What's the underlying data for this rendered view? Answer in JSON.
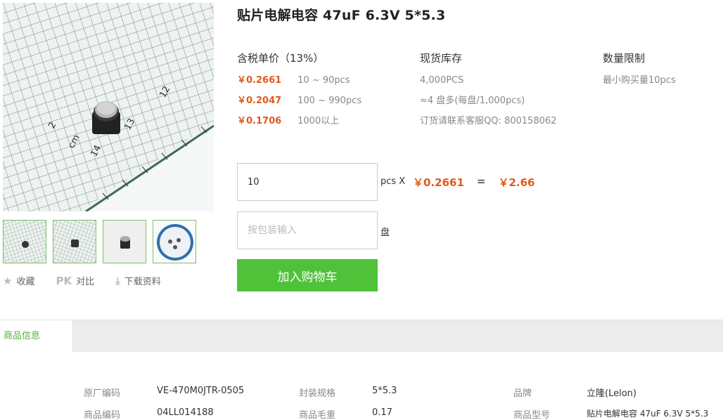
{
  "product": {
    "title": "贴片电解电容 47uF 6.3V 5*5.3"
  },
  "gallery": {
    "thumb_count": 4
  },
  "actions": [
    {
      "icon": "star-icon",
      "glyph": "★",
      "label": "收藏"
    },
    {
      "icon": "pk-icon",
      "glyph": "PK",
      "label": "对比"
    },
    {
      "icon": "download-icon",
      "glyph": "⤓",
      "label": "下载资料"
    }
  ],
  "pricing": {
    "header": "含税单价（13%）",
    "tiers": [
      {
        "price": "￥0.2661",
        "range": "10 ~ 90pcs"
      },
      {
        "price": "￥0.2047",
        "range": "100 ~ 990pcs"
      },
      {
        "price": "￥0.1706",
        "range": "1000以上"
      }
    ]
  },
  "stock": {
    "header": "现货库存",
    "lines": [
      "4,000PCS",
      "≈4 盘多(每盘/1,000pcs)",
      "订货请联系客服QQ: 800158062"
    ]
  },
  "limit": {
    "header": "数量限制",
    "lines": [
      "最小购买量10pcs"
    ]
  },
  "order": {
    "qty_value": "10",
    "qty_unit": "pcs X",
    "unit_price": "￥0.2661",
    "equals": "=",
    "total": "￥2.66",
    "pkg_placeholder": "按包装输入",
    "pkg_unit": "盘",
    "cart_label": "加入购物车"
  },
  "tabs": {
    "active_label": "商品信息"
  },
  "specs": [
    {
      "label": "原厂编码",
      "value": "VE-470M0JTR-0505"
    },
    {
      "label": "封装规格",
      "value": "5*5.3"
    },
    {
      "label": "品牌",
      "value": "立隆(Lelon)"
    },
    {
      "label": "商品编码",
      "value": "04LL014188"
    },
    {
      "label": "商品毛重",
      "value": "0.17"
    },
    {
      "label": "商品型号",
      "value": "贴片电解电容 47uF 6.3V 5*5.3"
    }
  ],
  "colors": {
    "accent_green": "#4fc23a",
    "price_orange": "#e05a1c"
  }
}
